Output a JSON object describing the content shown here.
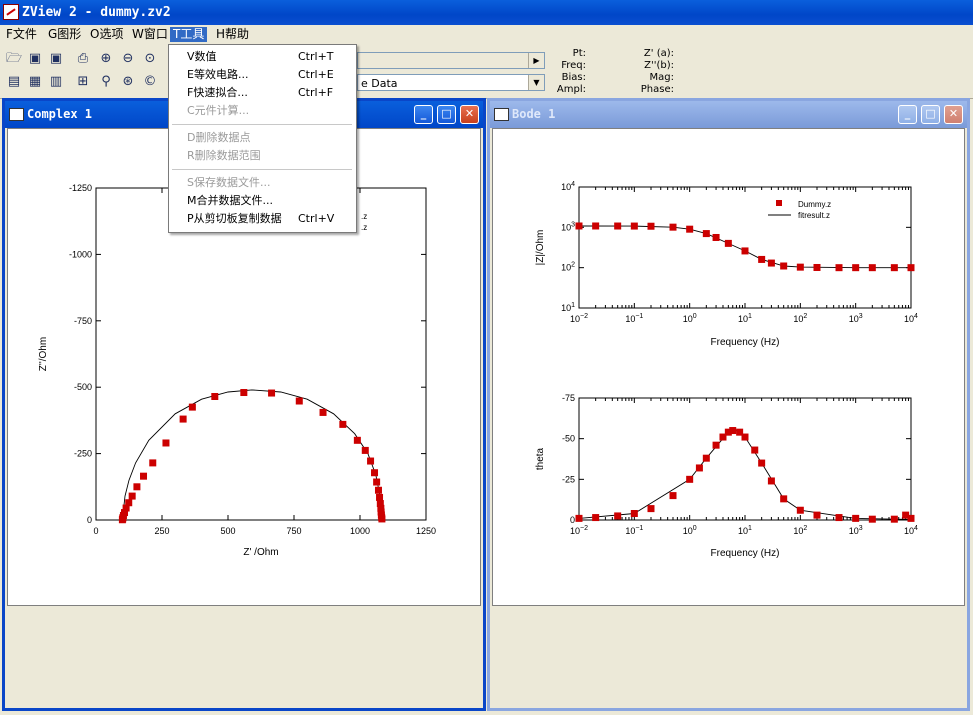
{
  "window": {
    "title": "ZView 2 - dummy.zv2"
  },
  "menubar": [
    {
      "label": "F文件"
    },
    {
      "label": "G图形"
    },
    {
      "label": "O选项"
    },
    {
      "label": "W窗口"
    },
    {
      "label": "T工具"
    },
    {
      "label": "H帮助"
    }
  ],
  "toolbar": {
    "combo_top": "",
    "combo_bottom": "e Data",
    "readout": {
      "pt_label": "Pt:",
      "freq_label": "Freq:",
      "bias_label": "Bias:",
      "ampl_label": "Ampl:",
      "zre_label": "Z' (a):",
      "zim_label": "Z''(b):",
      "mag_label": "Mag:",
      "phase_label": "Phase:"
    }
  },
  "tools_menu": {
    "items": [
      {
        "label": "V数值",
        "shortcut": "Ctrl+T",
        "enabled": true
      },
      {
        "label": "E等效电路...",
        "shortcut": "Ctrl+E",
        "enabled": true
      },
      {
        "label": "F快速拟合...",
        "shortcut": "Ctrl+F",
        "enabled": true
      },
      {
        "label": "C元件计算...",
        "shortcut": "",
        "enabled": false
      },
      {
        "label": "D删除数据点",
        "shortcut": "",
        "enabled": false
      },
      {
        "label": "R删除数据范围",
        "shortcut": "",
        "enabled": false
      },
      {
        "label": "S保存数据文件...",
        "shortcut": "",
        "enabled": false
      },
      {
        "label": "M合并数据文件...",
        "shortcut": "",
        "enabled": true
      },
      {
        "label": "P从剪切板复制数据",
        "shortcut": "Ctrl+V",
        "enabled": true
      }
    ]
  },
  "complex_window": {
    "title": "Complex 1",
    "legend_fragments": [
      ".z",
      ".z"
    ]
  },
  "bode_window": {
    "title": "Bode 1",
    "legend": {
      "data": "Dummy.z",
      "fit": "fitresult.z"
    }
  },
  "colors": {
    "data_marker": "#cc0000",
    "fit_line": "#000000",
    "title_active": "#0a46c8",
    "menu_highlight": "#316ac5"
  },
  "chart_data": [
    {
      "type": "scatter",
      "title": "",
      "xlabel": "Z' /Ohm",
      "ylabel": "Z''/Ohm",
      "xlim": [
        0,
        1250
      ],
      "ylim": [
        0,
        -1250
      ],
      "xticks": [
        "0",
        "250",
        "500",
        "750",
        "1000",
        "1250"
      ],
      "yticks": [
        "0",
        "-250",
        "-500",
        "-750",
        "-1000",
        "-1250"
      ],
      "grid": false,
      "series": [
        {
          "name": "Dummy.z",
          "marker": "square",
          "x": [
            100,
            101,
            102,
            104,
            108,
            114,
            124,
            137,
            155,
            180,
            215,
            265,
            330,
            365,
            450,
            560,
            665,
            770,
            860,
            935,
            990,
            1020,
            1040,
            1055,
            1063,
            1070,
            1074,
            1077,
            1079,
            1080,
            1081,
            1082,
            1083
          ],
          "y": [
            -1,
            -4,
            -9,
            -17,
            -28,
            -45,
            -65,
            -90,
            -125,
            -165,
            -215,
            -290,
            -380,
            -425,
            -465,
            -480,
            -478,
            -448,
            -405,
            -360,
            -300,
            -262,
            -222,
            -178,
            -143,
            -112,
            -85,
            -62,
            -44,
            -30,
            -19,
            -10,
            -4
          ]
        },
        {
          "name": "fitresult.z",
          "marker": "line",
          "x": [
            100,
            110,
            125,
            150,
            200,
            300,
            400,
            500,
            590,
            700,
            800,
            900,
            980,
            1030,
            1060,
            1080,
            1090
          ],
          "y": [
            0,
            -90,
            -150,
            -215,
            -300,
            -400,
            -455,
            -482,
            -490,
            -482,
            -455,
            -400,
            -325,
            -250,
            -170,
            -70,
            0
          ]
        }
      ]
    },
    {
      "type": "scatter",
      "title": "",
      "xlabel": "Frequency (Hz)",
      "ylabel": "|Z|/Ohm",
      "xscale": "log",
      "yscale": "log",
      "xlim": [
        0.01,
        10000
      ],
      "ylim": [
        10,
        10000
      ],
      "xticks": [
        "10^-2",
        "10^-1",
        "10^0",
        "10^1",
        "10^2",
        "10^3",
        "10^4"
      ],
      "yticks": [
        "10^1",
        "10^2",
        "10^3",
        "10^4"
      ],
      "legend_position": "top-right",
      "series": [
        {
          "name": "Dummy.z",
          "marker": "square",
          "x": [
            0.01,
            0.02,
            0.05,
            0.1,
            0.2,
            0.5,
            1,
            2,
            3,
            5,
            10,
            20,
            30,
            50,
            100,
            200,
            500,
            1000,
            2000,
            5000,
            10000
          ],
          "y": [
            1080,
            1080,
            1078,
            1075,
            1065,
            1010,
            900,
            700,
            560,
            400,
            260,
            160,
            130,
            110,
            103,
            101,
            100,
            100,
            100,
            100,
            100
          ]
        },
        {
          "name": "fitresult.z",
          "marker": "line",
          "x": [
            0.01,
            0.1,
            0.5,
            1,
            2,
            5,
            10,
            20,
            50,
            100,
            1000,
            10000
          ],
          "y": [
            1080,
            1075,
            1010,
            900,
            700,
            400,
            260,
            160,
            110,
            103,
            100,
            100
          ]
        }
      ]
    },
    {
      "type": "scatter",
      "title": "",
      "xlabel": "Frequency (Hz)",
      "ylabel": "theta",
      "xscale": "log",
      "xlim": [
        0.01,
        10000
      ],
      "ylim": [
        0,
        -75
      ],
      "xticks": [
        "10^-2",
        "10^-1",
        "10^0",
        "10^1",
        "10^2",
        "10^3",
        "10^4"
      ],
      "yticks": [
        "0",
        "-25",
        "-50",
        "-75"
      ],
      "series": [
        {
          "name": "Dummy.z",
          "marker": "square",
          "x": [
            0.01,
            0.02,
            0.05,
            0.1,
            0.2,
            0.5,
            1,
            1.5,
            2,
            3,
            4,
            5,
            6,
            8,
            10,
            15,
            20,
            30,
            50,
            100,
            200,
            500,
            1000,
            2000,
            5000,
            8000,
            10000
          ],
          "y": [
            -1,
            -1.5,
            -2.5,
            -4,
            -7,
            -15,
            -25,
            -32,
            -38,
            -46,
            -51,
            -54,
            -55,
            -54,
            -51,
            -43,
            -35,
            -24,
            -13,
            -6,
            -3,
            -1.5,
            -1,
            -0.5,
            -0.5,
            -3,
            -1
          ]
        },
        {
          "name": "fitresult.z",
          "marker": "line",
          "x": [
            0.01,
            0.1,
            1,
            2,
            5,
            7,
            10,
            20,
            50,
            100,
            1000,
            10000
          ],
          "y": [
            -1,
            -4,
            -25,
            -38,
            -54,
            -55,
            -51,
            -35,
            -13,
            -6,
            -1,
            -0.3
          ]
        }
      ]
    }
  ]
}
